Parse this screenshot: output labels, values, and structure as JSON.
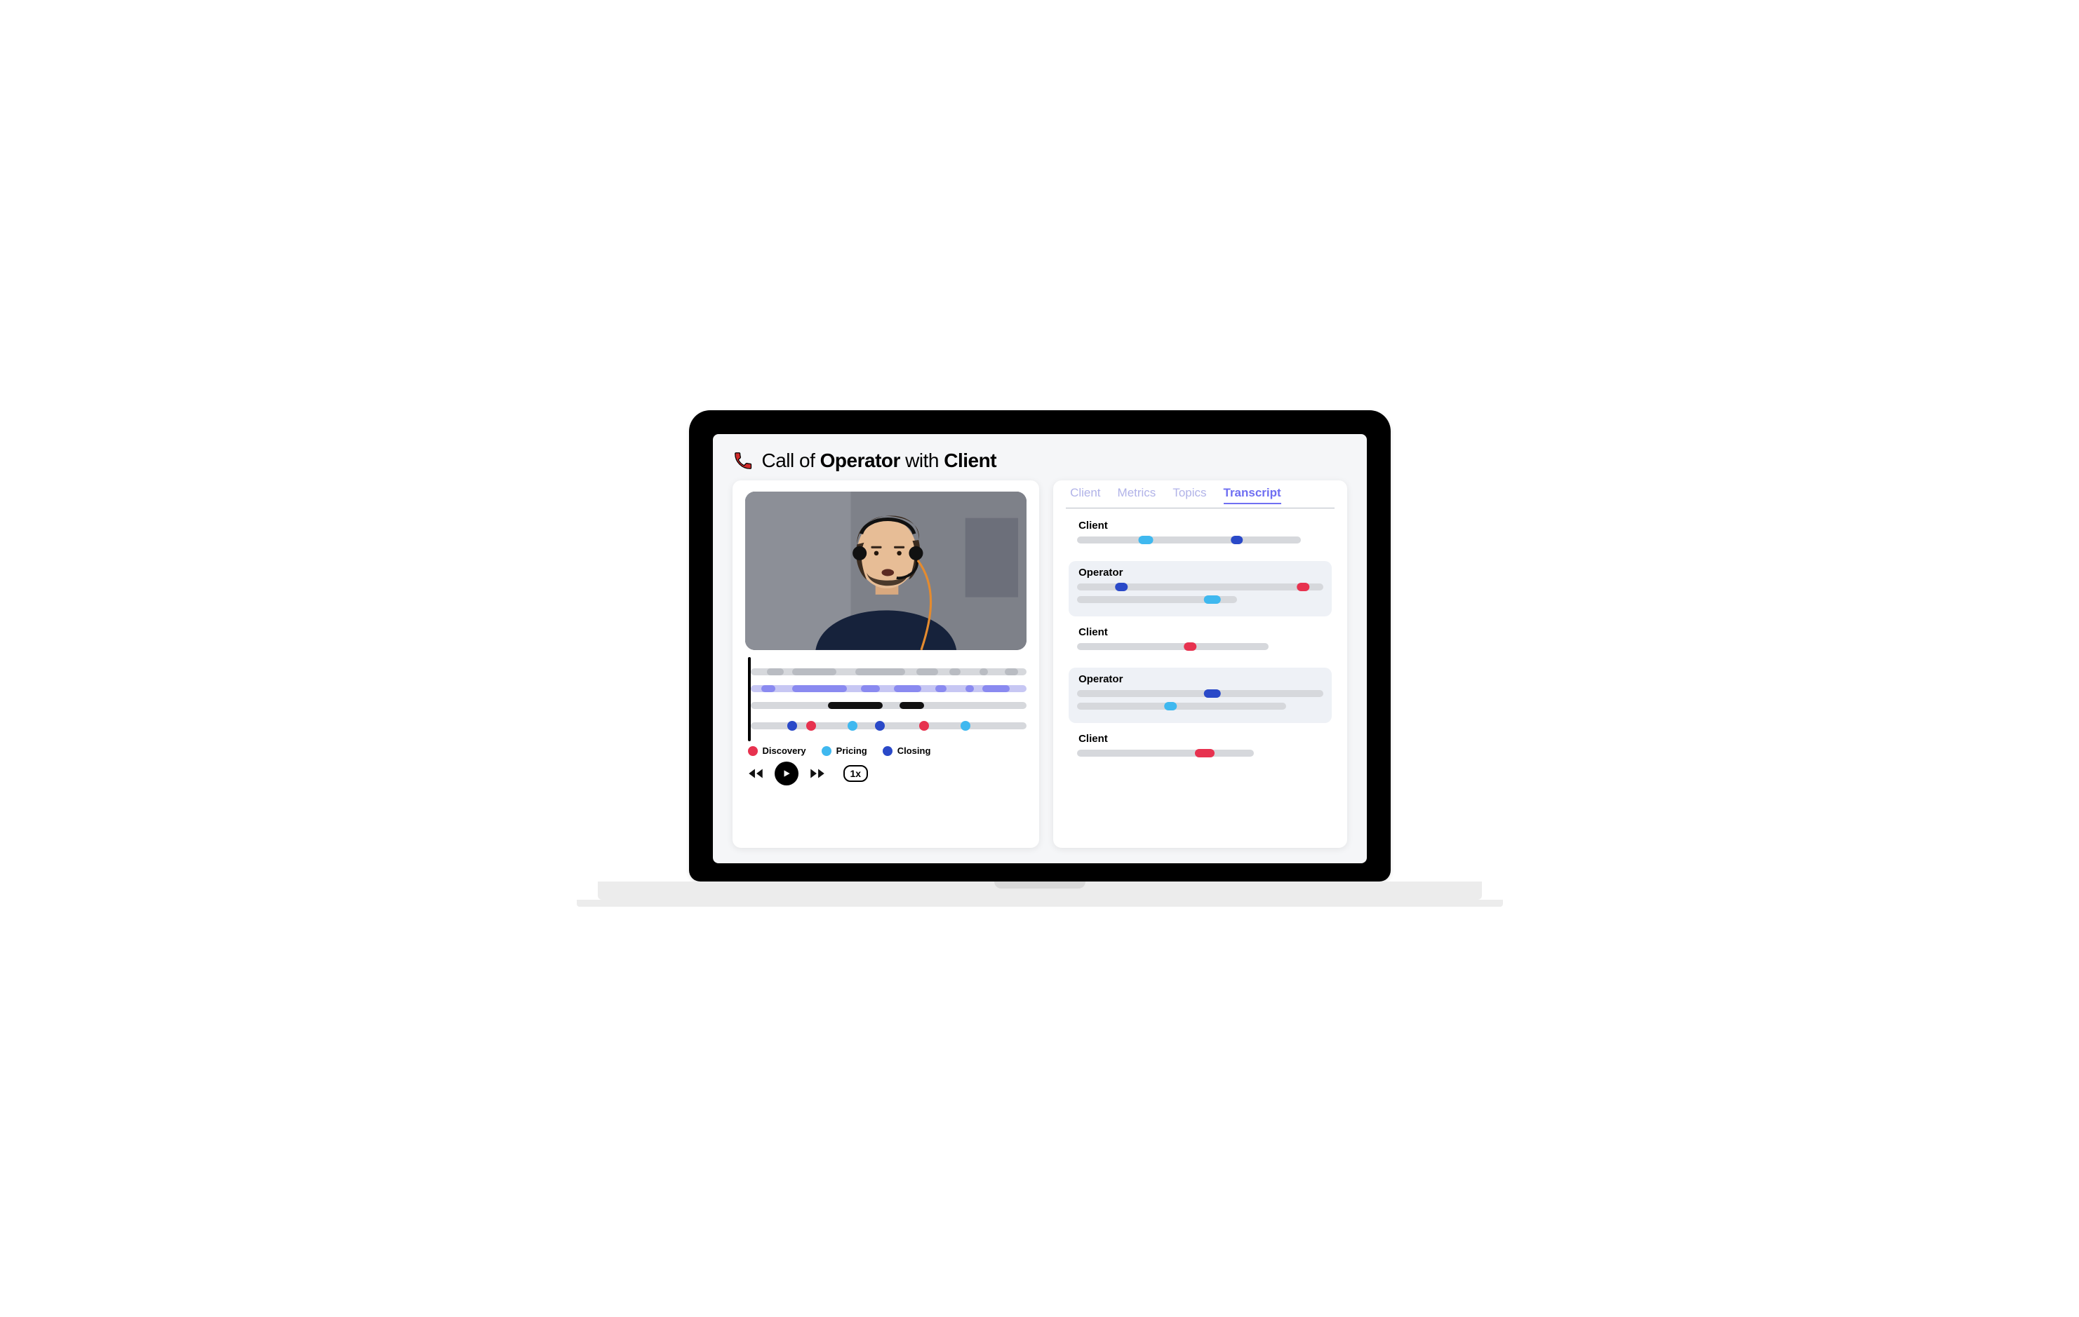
{
  "title": {
    "pre": "Call of ",
    "operator": "Operator",
    "mid": " with ",
    "client": "Client"
  },
  "playback": {
    "speed_label": "1x"
  },
  "legend": {
    "discovery": "Discovery",
    "pricing": "Pricing",
    "closing": "Closing"
  },
  "colors": {
    "discovery": "#e7324f",
    "pricing": "#3fb8ef",
    "closing": "#2a49c8",
    "track_gray": "#b9bcc2",
    "track_graylt": "#d6d8dc",
    "track_purple": "#8a8af0",
    "track_purplelt": "#c7c7f3",
    "track_black": "#111"
  },
  "timeline": {
    "playhead_pct": 1,
    "rows": [
      {
        "bg": "graylt",
        "segments": [
          {
            "l": 6,
            "w": 6,
            "c": "gray"
          },
          {
            "l": 15,
            "w": 16,
            "c": "gray"
          },
          {
            "l": 38,
            "w": 18,
            "c": "gray"
          },
          {
            "l": 60,
            "w": 8,
            "c": "gray"
          },
          {
            "l": 72,
            "w": 4,
            "c": "gray"
          },
          {
            "l": 83,
            "w": 3,
            "c": "gray"
          },
          {
            "l": 92,
            "w": 5,
            "c": "gray"
          }
        ]
      },
      {
        "bg": "purplelt",
        "segments": [
          {
            "l": 4,
            "w": 5,
            "c": "purple"
          },
          {
            "l": 15,
            "w": 20,
            "c": "purple"
          },
          {
            "l": 40,
            "w": 7,
            "c": "purple"
          },
          {
            "l": 52,
            "w": 10,
            "c": "purple"
          },
          {
            "l": 67,
            "w": 4,
            "c": "purple"
          },
          {
            "l": 78,
            "w": 3,
            "c": "purple"
          },
          {
            "l": 84,
            "w": 10,
            "c": "purple"
          }
        ]
      },
      {
        "bg": "graylt",
        "segments": [
          {
            "l": 28,
            "w": 20,
            "c": "black"
          },
          {
            "l": 54,
            "w": 9,
            "c": "black"
          }
        ]
      },
      {
        "bg": "graylt",
        "topics": true,
        "markers": [
          {
            "x": 15,
            "c": "navy"
          },
          {
            "x": 22,
            "c": "red"
          },
          {
            "x": 37,
            "c": "sky"
          },
          {
            "x": 47,
            "c": "navy"
          },
          {
            "x": 63,
            "c": "red"
          },
          {
            "x": 78,
            "c": "sky"
          }
        ]
      }
    ]
  },
  "tabs": [
    {
      "label": "Client",
      "active": false
    },
    {
      "label": "Metrics",
      "active": false
    },
    {
      "label": "Topics",
      "active": false
    },
    {
      "label": "Transcript",
      "active": true
    }
  ],
  "transcript": [
    {
      "speaker": "Client",
      "selected": false,
      "lines": [
        {
          "w": 91,
          "pills": [
            {
              "x": 28,
              "w": 6,
              "c": "sky"
            },
            {
              "x": 65,
              "w": 5,
              "c": "navy"
            }
          ]
        }
      ]
    },
    {
      "speaker": "Operator",
      "selected": true,
      "lines": [
        {
          "w": 100,
          "pills": [
            {
              "x": 18,
              "w": 5,
              "c": "navy"
            },
            {
              "x": 92,
              "w": 5,
              "c": "red"
            }
          ]
        },
        {
          "w": 65,
          "pills": [
            {
              "x": 55,
              "w": 7,
              "c": "sky"
            }
          ]
        }
      ]
    },
    {
      "speaker": "Client",
      "selected": false,
      "lines": [
        {
          "w": 78,
          "pills": [
            {
              "x": 46,
              "w": 5,
              "c": "red"
            }
          ]
        }
      ]
    },
    {
      "speaker": "Operator",
      "selected": true,
      "lines": [
        {
          "w": 100,
          "pills": [
            {
              "x": 55,
              "w": 7,
              "c": "navy"
            }
          ]
        },
        {
          "w": 85,
          "pills": [
            {
              "x": 38,
              "w": 5,
              "c": "sky"
            }
          ]
        }
      ]
    },
    {
      "speaker": "Client",
      "selected": false,
      "lines": [
        {
          "w": 72,
          "pills": [
            {
              "x": 52,
              "w": 8,
              "c": "red"
            }
          ]
        }
      ]
    }
  ]
}
